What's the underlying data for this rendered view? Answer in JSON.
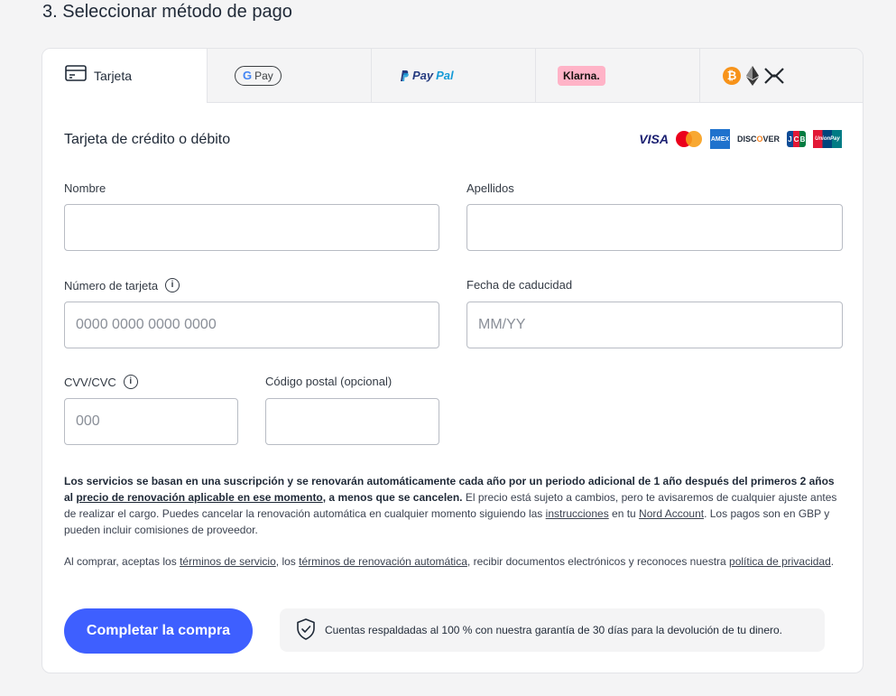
{
  "section_title": "3. Seleccionar método de pago",
  "tabs": [
    {
      "id": "card",
      "label": "Tarjeta",
      "icon": "credit-card-icon",
      "active": true
    },
    {
      "id": "gpay",
      "label": "Pay",
      "icon": "google-pay-logo"
    },
    {
      "id": "paypal",
      "label_1": "Pay",
      "label_2": "Pal",
      "icon": "paypal-logo"
    },
    {
      "id": "klarna",
      "label": "Klarna.",
      "icon": "klarna-logo"
    },
    {
      "id": "crypto",
      "icons": [
        "bitcoin-icon",
        "ethereum-icon",
        "xrp-icon"
      ],
      "bitcoin_glyph": "₿"
    }
  ],
  "form": {
    "heading": "Tarjeta de crédito o débito",
    "card_brands": {
      "visa": "VISA",
      "amex": "AMEX",
      "discover_1": "DISC",
      "discover_2": "O",
      "discover_3": "VER",
      "jcb": [
        "J",
        "C",
        "B"
      ],
      "unionpay": "UnionPay"
    },
    "first_name_label": "Nombre",
    "first_name_value": "",
    "last_name_label": "Apellidos",
    "last_name_value": "",
    "card_number_label": "Número de tarjeta",
    "card_number_placeholder": "0000 0000 0000 0000",
    "expiry_label": "Fecha de caducidad",
    "expiry_placeholder": "MM/YY",
    "cvv_label": "CVV/CVC",
    "cvv_placeholder": "000",
    "postal_label": "Código postal (opcional)",
    "postal_value": "",
    "info_glyph": "i"
  },
  "legal": {
    "p1_bold_1": "Los servicios se basan en una suscripción y se renovarán automáticamente cada año por un periodo adicional de 1 año después del primeros 2 años al ",
    "p1_link_renewal_price": "precio de renovación aplicable en ese momento",
    "p1_bold_2": ", a menos que se cancelen.",
    "p1_text_1": " El precio está sujeto a cambios, pero te avisaremos de cualquier ajuste antes de realizar el cargo. Puedes cancelar la renovación automática en cualquier momento siguiendo las ",
    "p1_link_instructions": "instrucciones",
    "p1_text_2": " en tu ",
    "p1_link_account": "Nord Account",
    "p1_text_3": ". Los pagos son en GBP y pueden incluir comisiones de proveedor.",
    "p2_text_1": "Al comprar, aceptas los ",
    "p2_link_tos": "términos de servicio",
    "p2_text_2": ", los ",
    "p2_link_renewal_terms": "términos de renovación automática",
    "p2_text_3": ", recibir documentos electrónicos y reconoces nuestra ",
    "p2_link_privacy": "política de privacidad",
    "p2_text_4": "."
  },
  "actions": {
    "complete_purchase_label": "Completar la compra",
    "guarantee_text": "Cuentas respaldadas al 100 % con nuestra garantía de 30 días para la devolución de tu dinero."
  },
  "colors": {
    "accent": "#3e5fff",
    "klarna_pink": "#ffb3c7",
    "bitcoin_orange": "#f7931a"
  }
}
